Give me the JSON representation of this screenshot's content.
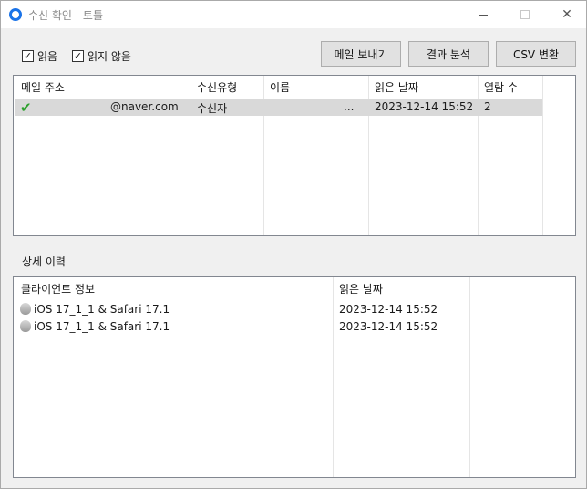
{
  "window": {
    "title": "수신 확인 - 토틀",
    "minimize": "",
    "maximize": "",
    "close": "✕"
  },
  "filters": {
    "read_label": "읽음",
    "unread_label": "읽지 않음",
    "read_checked": true,
    "unread_checked": true
  },
  "toolbar": {
    "send_mail": "메일 보내기",
    "analyze": "결과 분석",
    "csv": "CSV 변환"
  },
  "recipients": {
    "columns": [
      "메일 주소",
      "수신유형",
      "이름",
      "읽은 날짜",
      "열람 수"
    ],
    "rows": [
      {
        "email": "@naver.com",
        "type": "수신자",
        "name": "...",
        "read_date": "2023-12-14 15:52",
        "open_count": "2"
      }
    ]
  },
  "detail": {
    "label": "상세 이력",
    "columns": [
      "클라이언트 정보",
      "읽은 날짜"
    ],
    "rows": [
      {
        "client": "iOS 17_1_1 & Safari 17.1",
        "read_date": "2023-12-14 15:52"
      },
      {
        "client": "iOS 17_1_1 & Safari 17.1",
        "read_date": "2023-12-14 15:52"
      }
    ]
  }
}
